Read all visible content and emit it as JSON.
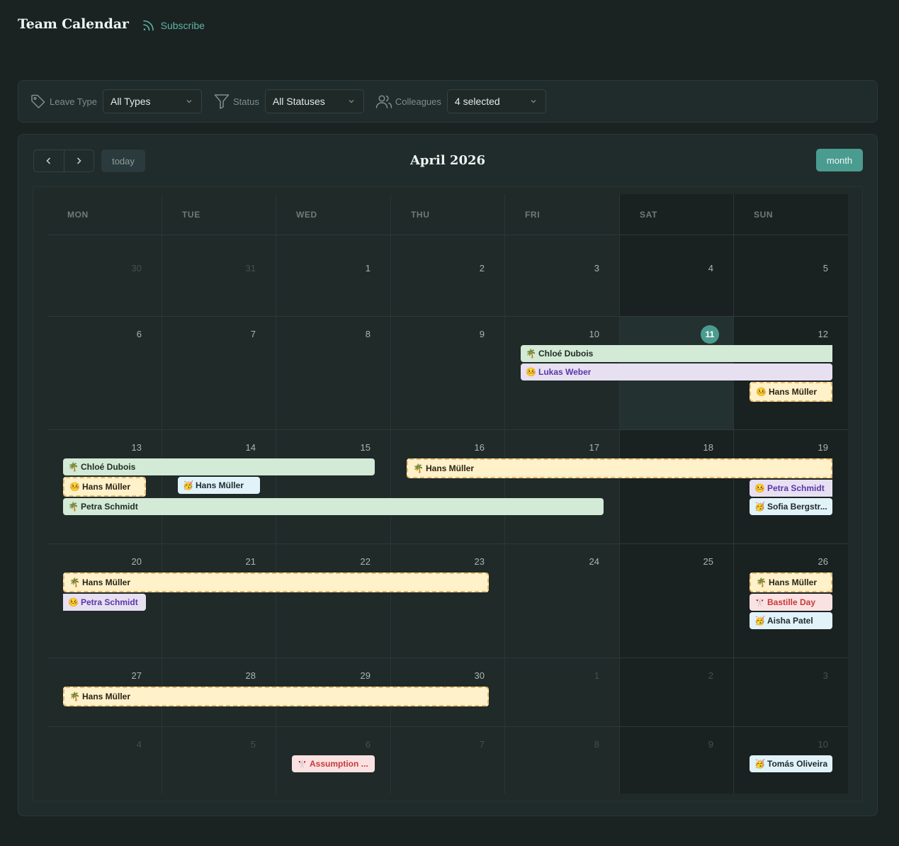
{
  "header": {
    "title": "Team Calendar",
    "subscribe_label": "Subscribe"
  },
  "filters": {
    "leave_type": {
      "label": "Leave Type",
      "value": "All Types"
    },
    "status": {
      "label": "Status",
      "value": "All Statuses"
    },
    "colleagues": {
      "label": "Colleagues",
      "value": "4 selected"
    }
  },
  "toolbar": {
    "today_label": "today",
    "month_title": "April 2026",
    "view_label": "month"
  },
  "weekdays": [
    "MON",
    "TUE",
    "WED",
    "THU",
    "FRI",
    "SAT",
    "SUN"
  ],
  "weeks": [
    [
      "30",
      "31",
      "1",
      "2",
      "3",
      "4",
      "5"
    ],
    [
      "6",
      "7",
      "8",
      "9",
      "10",
      "11",
      "12"
    ],
    [
      "13",
      "14",
      "15",
      "16",
      "17",
      "18",
      "19"
    ],
    [
      "20",
      "21",
      "22",
      "23",
      "24",
      "25",
      "26"
    ],
    [
      "27",
      "28",
      "29",
      "30",
      "1",
      "2",
      "3"
    ],
    [
      "4",
      "5",
      "6",
      "7",
      "8",
      "9",
      "10"
    ]
  ],
  "today": "11",
  "events": {
    "w2_chloe": {
      "label": "Chloé Dubois",
      "icon": "🌴"
    },
    "w2_lukas": {
      "label": "Lukas Weber",
      "icon": "🤒"
    },
    "w2_hans": {
      "label": "Hans Müller",
      "icon": "🤒"
    },
    "w3_chloe": {
      "label": "Chloé Dubois",
      "icon": "🌴"
    },
    "w3_hans_pend": {
      "label": "Hans Müller",
      "icon": "🌴"
    },
    "w3_hans_sick": {
      "label": "Hans Müller",
      "icon": "🤒"
    },
    "w3_hans_home": {
      "label": "Hans Müller",
      "icon": "🥳"
    },
    "w3_petra_vac": {
      "label": "Petra Schmidt",
      "icon": "🌴"
    },
    "w3_petra_sick": {
      "label": "Petra Schmidt",
      "icon": "🤒"
    },
    "w3_sofia": {
      "label": "Sofia Bergstr...",
      "icon": "🥳"
    },
    "w4_hans": {
      "label": "Hans Müller",
      "icon": "🌴"
    },
    "w4_petra": {
      "label": "Petra Schmidt",
      "icon": "🤒"
    },
    "w4_hans_sun": {
      "label": "Hans Müller",
      "icon": "🌴"
    },
    "w4_bastille": {
      "label": "Bastille Day",
      "icon": "🎌"
    },
    "w4_aisha": {
      "label": "Aisha Patel",
      "icon": "🥳"
    },
    "w5_hans": {
      "label": "Hans Müller",
      "icon": "🌴"
    },
    "w6_assumption": {
      "label": "Assumption ...",
      "icon": "🎌"
    },
    "w6_tomas": {
      "label": "Tomás Oliveira",
      "icon": "🥳"
    }
  }
}
